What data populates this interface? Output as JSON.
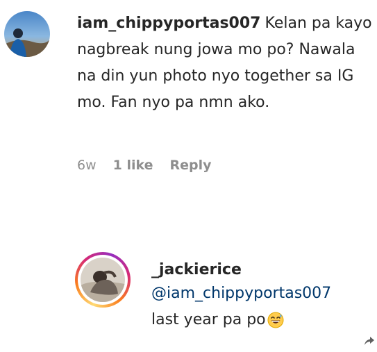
{
  "comment": {
    "avatar_icon": "profile-photo-icon",
    "username": "iam_chippyportas007",
    "text": "Kelan pa kayo nagbreak nung jowa mo po? Nawala na din yun photo nyo together sa IG mo. Fan nyo pa nmn ako.",
    "time": "6w",
    "likes": "1 like",
    "reply_label": "Reply"
  },
  "reply": {
    "avatar_icon": "profile-photo-icon",
    "username": "_jackierice",
    "mention": "@iam_chippyportas007",
    "text": "last year pa po",
    "emoji_icon": "grinning-sweat-emoji-icon",
    "share_icon": "share-arrow-icon"
  },
  "colors": {
    "text": "#262626",
    "meta": "#8e8e8e",
    "mention": "#00376b"
  }
}
